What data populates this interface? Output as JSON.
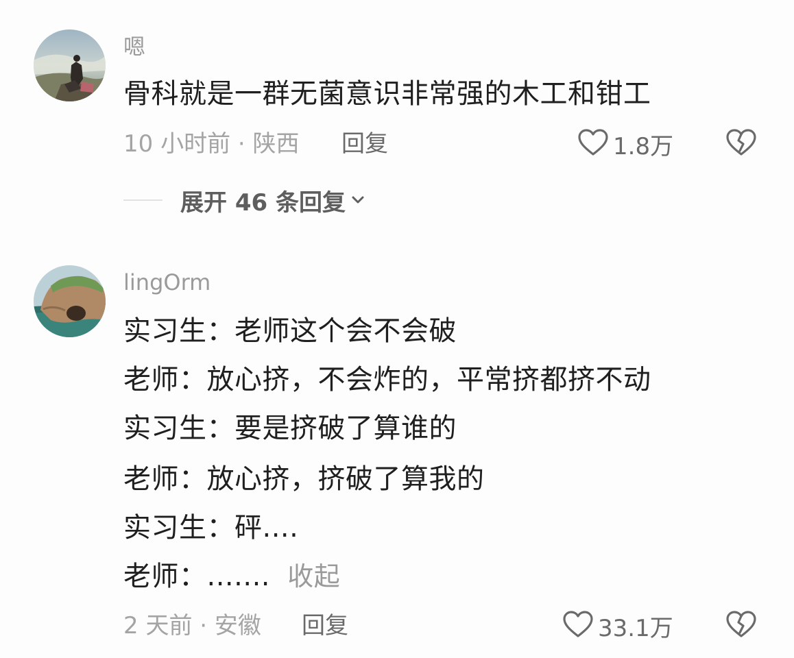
{
  "comments": [
    {
      "username": "嗯",
      "lines": [
        "骨科就是一群无菌意识非常强的木工和钳工"
      ],
      "meta": "10 小时前 · 陕西",
      "reply_label": "回复",
      "likes": "1.8万",
      "expand_label": "展开 46 条回复"
    },
    {
      "username": "lingOrm",
      "lines": [
        "实习生：老师这个会不会破",
        "老师：放心挤，不会炸的，平常挤都挤不动",
        "实习生：要是挤破了算谁的",
        "老师：放心挤，挤破了算我的",
        "实习生：砰....",
        "老师：......."
      ],
      "collapse_label": "收起",
      "meta": "2 天前 · 安徽",
      "reply_label": "回复",
      "likes": "33.1万"
    }
  ],
  "icons": {
    "like": "heart-outline-icon",
    "dislike": "broken-heart-icon",
    "expand": "chevron-down-icon"
  },
  "colors": {
    "text": "#1f1f1f",
    "secondary": "#9a9a9a",
    "icon": "#6a6a6a"
  }
}
